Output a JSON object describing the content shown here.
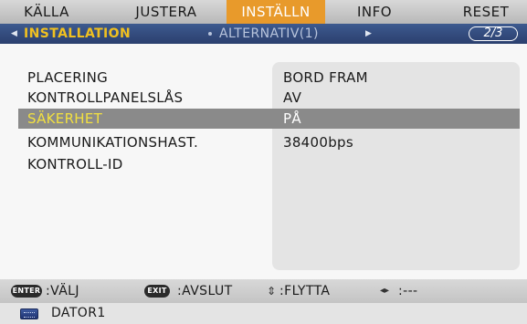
{
  "menu": {
    "tabs": [
      {
        "label": "KÄLLA"
      },
      {
        "label": "JUSTERA"
      },
      {
        "label": "INSTÄLLN",
        "active": true
      },
      {
        "label": "INFO"
      },
      {
        "label": "RESET"
      }
    ]
  },
  "subtabs": {
    "left_arrow": "◀",
    "active": "INSTALLATION",
    "next": "ALTERNATIV(1)",
    "right_arrow": "▶",
    "page": "2/3"
  },
  "settings": {
    "rows": [
      {
        "label": "PLACERING",
        "value": "BORD FRAM"
      },
      {
        "label": "KONTROLLPANELSLÅS",
        "value": "AV"
      },
      {
        "label": "SÄKERHET",
        "value": "PÅ",
        "selected": true
      },
      {
        "label": "KOMMUNIKATIONSHAST.",
        "value": "38400bps"
      },
      {
        "label": "KONTROLL-ID",
        "value": ""
      }
    ]
  },
  "help": {
    "enter_key": "ENTER",
    "enter_text": ":VÄLJ",
    "exit_key": "EXIT",
    "exit_text": ":AVSLUT",
    "move_icon": "⇕",
    "move_text": ":FLYTTA",
    "lr_icon": "◂▸",
    "lr_text": ":---"
  },
  "source": {
    "icon": "computer-icon",
    "label": "DATOR1"
  },
  "colors": {
    "active_tab": "#e89a2b",
    "subbar": "#2f4578",
    "highlight_label": "#f2e040",
    "selected_row": "#8a8a8a"
  }
}
